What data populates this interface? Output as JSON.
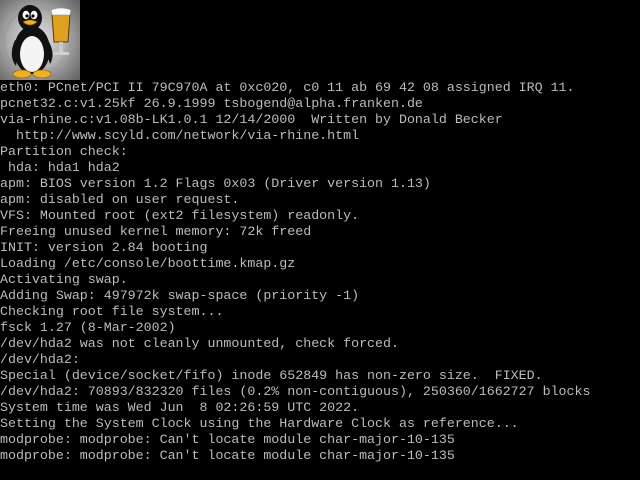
{
  "screen": {
    "background_color": "#000000",
    "text_color": "#bcbcbc",
    "logo_icon": "tux-penguin-beer-logo-icon"
  },
  "console": {
    "lines": [
      "eth0: PCnet/PCI II 79C970A at 0xc020, c0 11 ab 69 42 08 assigned IRQ 11.",
      "pcnet32.c:v1.25kf 26.9.1999 tsbogend@alpha.franken.de",
      "via-rhine.c:v1.08b-LK1.0.1 12/14/2000  Written by Donald Becker",
      "  http://www.scyld.com/network/via-rhine.html",
      "Partition check:",
      " hda: hda1 hda2",
      "apm: BIOS version 1.2 Flags 0x03 (Driver version 1.13)",
      "apm: disabled on user request.",
      "VFS: Mounted root (ext2 filesystem) readonly.",
      "Freeing unused kernel memory: 72k freed",
      "INIT: version 2.84 booting",
      "Loading /etc/console/boottime.kmap.gz",
      "Activating swap.",
      "Adding Swap: 497972k swap-space (priority -1)",
      "Checking root file system...",
      "fsck 1.27 (8-Mar-2002)",
      "/dev/hda2 was not cleanly unmounted, check forced.",
      "/dev/hda2:",
      "Special (device/socket/fifo) inode 652849 has non-zero size.  FIXED.",
      "/dev/hda2: 70893/832320 files (0.2% non-contiguous), 250360/1662727 blocks",
      "System time was Wed Jun  8 02:26:59 UTC 2022.",
      "Setting the System Clock using the Hardware Clock as reference...",
      "modprobe: modprobe: Can't locate module char-major-10-135",
      "modprobe: modprobe: Can't locate module char-major-10-135"
    ]
  }
}
